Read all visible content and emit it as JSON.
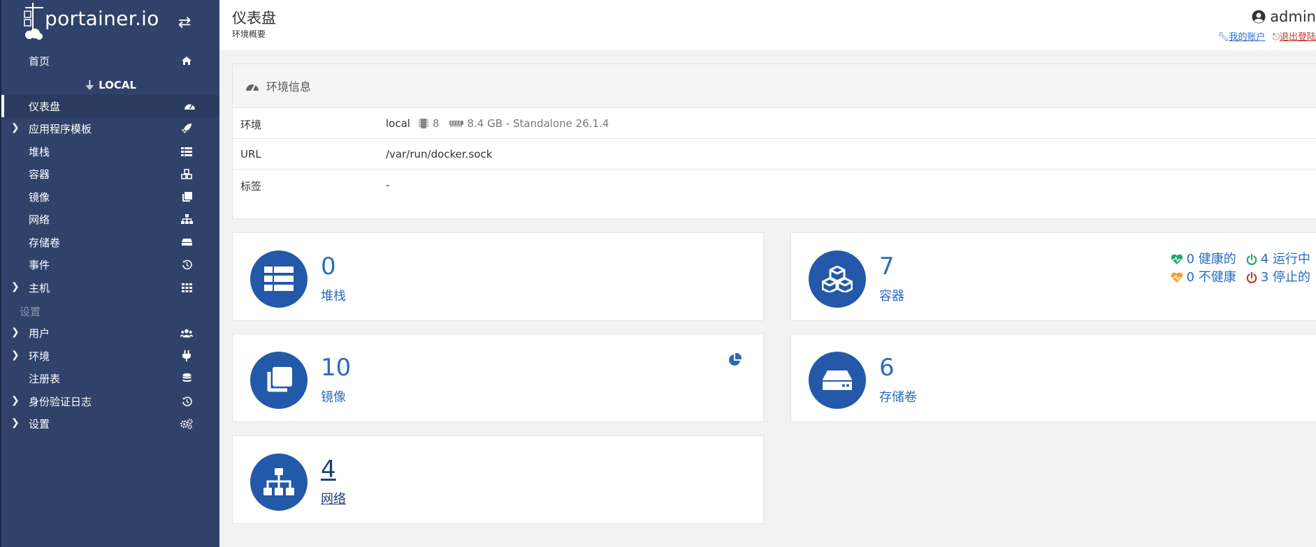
{
  "sidebar": {
    "brand": "portainer.io",
    "items": {
      "home": "首页",
      "env_section": "LOCAL",
      "dashboard": "仪表盘",
      "app_templates": "应用程序模板",
      "stacks": "堆栈",
      "containers": "容器",
      "images": "镜像",
      "networks": "网络",
      "volumes": "存储卷",
      "events": "事件",
      "host": "主机",
      "settings_title": "设置",
      "users": "用户",
      "environments": "环境",
      "registries": "注册表",
      "auth_logs": "身份验证日志",
      "settings": "设置"
    }
  },
  "header": {
    "title": "仪表盘",
    "subtitle": "环境概要",
    "username": "admin",
    "my_account": "我的账户",
    "logout": "退出登陆"
  },
  "env_info": {
    "title": "环境信息",
    "rows": {
      "env_label": "环境",
      "env_name": "local",
      "cpu": "8",
      "memory_platform": "8.4 GB - Standalone 26.1.4",
      "url_label": "URL",
      "url_value": "/var/run/docker.sock",
      "tags_label": "标签",
      "tags_value": "-"
    }
  },
  "cards": {
    "stacks": {
      "count": "0",
      "label": "堆栈"
    },
    "containers": {
      "count": "7",
      "label": "容器",
      "healthy": "0 健康的",
      "running": "4 运行中",
      "unhealthy": "0 不健康",
      "stopped": "3 停止的"
    },
    "images": {
      "count": "10",
      "label": "镜像"
    },
    "volumes": {
      "count": "6",
      "label": "存储卷"
    },
    "networks": {
      "count": "4",
      "label": "网络"
    }
  },
  "colors": {
    "sidebar_bg": "#30426a",
    "accent_blue": "#2359a8",
    "healthy_green": "#23a86e",
    "unhealthy_orange": "#f0a030",
    "stopped_red": "#c0392b"
  }
}
